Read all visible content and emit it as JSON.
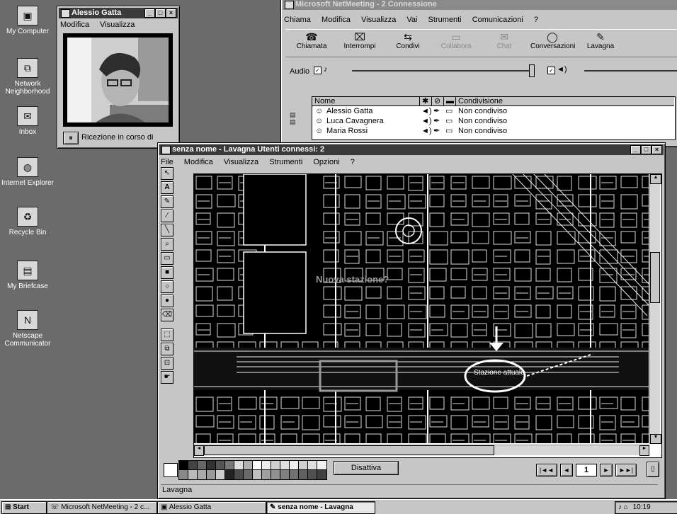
{
  "desktop": {
    "icons": [
      {
        "label": "My Computer",
        "icon": "computer-icon"
      },
      {
        "label": "Network Neighborhood",
        "icon": "network-icon"
      },
      {
        "label": "Inbox",
        "icon": "inbox-icon"
      },
      {
        "label": "Internet Explorer",
        "icon": "globe-icon"
      },
      {
        "label": "Recycle Bin",
        "icon": "recycle-bin-icon"
      },
      {
        "label": "My Briefcase",
        "icon": "briefcase-icon"
      },
      {
        "label": "Netscape Communicator",
        "icon": "netscape-icon"
      }
    ]
  },
  "video_window": {
    "title": "Alessio Gatta",
    "menu": [
      "Modifica",
      "Visualizza"
    ],
    "status_button": "⏸",
    "status_text": "Ricezione in corso di"
  },
  "netmeeting": {
    "title": "Microsoft NetMeeting - 2 Connessione",
    "menu": [
      "Chiama",
      "Modifica",
      "Visualizza",
      "Vai",
      "Strumenti",
      "Comunicazioni",
      "?"
    ],
    "toolbar": [
      "Chiamata",
      "Interrompi",
      "Condivi",
      "Collabora",
      "Chat",
      "Conversazioni",
      "Lavagna"
    ],
    "audio_label": "Audio",
    "table": {
      "headers": [
        "Nome",
        "",
        "",
        "",
        "Condivisione"
      ],
      "rows": [
        {
          "name": "Alessio Gatta",
          "status": "Non condiviso"
        },
        {
          "name": "Luca Cavagnera",
          "status": "Non condiviso"
        },
        {
          "name": "Maria Rossi",
          "status": "Non condiviso"
        }
      ]
    }
  },
  "whiteboard": {
    "title": "senza nome - Lavagna  Utenti connessi: 2",
    "menu": [
      "File",
      "Modifica",
      "Visualizza",
      "Strumenti",
      "Opzioni",
      "?"
    ],
    "map_labels": {
      "new_station": "Nuova stazione?",
      "old_station": "Stazione attuale"
    },
    "palette_colors": [
      "#000000",
      "#888888",
      "#444444",
      "#bbbbbb",
      "#666666",
      "#aaaaaa",
      "#333333",
      "#999999",
      "#555555",
      "#cccccc",
      "#777777",
      "#222222",
      "#dddddd",
      "#4a4a4a",
      "#b0b0b0",
      "#6a6a6a",
      "#ffffff",
      "#c0c0c0",
      "#eeeeee",
      "#a0a0a0",
      "#d0d0d0",
      "#909090",
      "#e0e0e0",
      "#808080",
      "#f0f0f0",
      "#707070",
      "#cfcfcf",
      "#606060",
      "#dfdfdf",
      "#505050",
      "#efefef",
      "#404040"
    ],
    "page_nav": {
      "page": "1",
      "first": "|◄◄",
      "prev": "◄",
      "next": "►",
      "last": "►►|"
    },
    "status": "Lavagna",
    "ok_button": "Disattiva"
  },
  "taskbar": {
    "start": "Start",
    "tasks": [
      "Microsoft NetMeeting - 2 c...",
      "Alessio Gatta",
      "senza nome - Lavagna"
    ],
    "clock": "10:19"
  }
}
